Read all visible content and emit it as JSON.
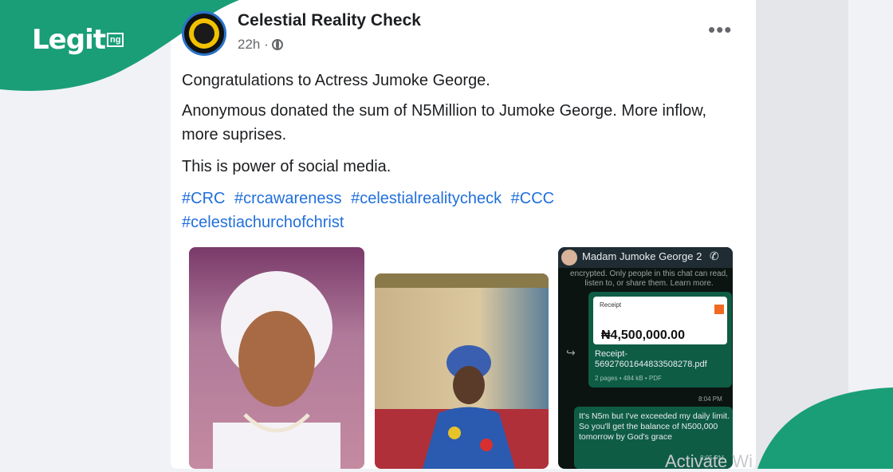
{
  "brand": {
    "logo_text": "Legit",
    "logo_suffix": "ng",
    "accent": "#1a9e77"
  },
  "post": {
    "page_name": "Celestial Reality Check",
    "time": "22h ·",
    "menu_icon": "more-horizontal-icon",
    "lines": [
      "Congratulations to Actress Jumoke George.",
      "Anonymous donated the sum of N5Million to Jumoke George. More inflow, more suprises.",
      "This is power of social media."
    ],
    "hashtags": [
      "#CRC",
      "#crcawareness",
      "#celestialrealitycheck",
      "#CCC",
      "#celestiachurchofchrist"
    ]
  },
  "chat": {
    "contact_name": "Madam Jumoke George 2",
    "notice": "encrypted. Only people in this chat can read, listen to, or share them. Learn more.",
    "receipt_title": "Receipt",
    "receipt_amount": "₦4,500,000.00",
    "receipt_filename": "Receipt-56927601644833508278.pdf",
    "receipt_meta": "2 pages • 484 kB • PDF",
    "receipt_time": "8:04 PM",
    "message": "It's N5m but I've exceeded my daily limit. So you'll get the balance of N500,000 tomorrow by God's grace",
    "message_time": "8:05 PM"
  },
  "overlay": {
    "watermark": "Activate Wi"
  }
}
